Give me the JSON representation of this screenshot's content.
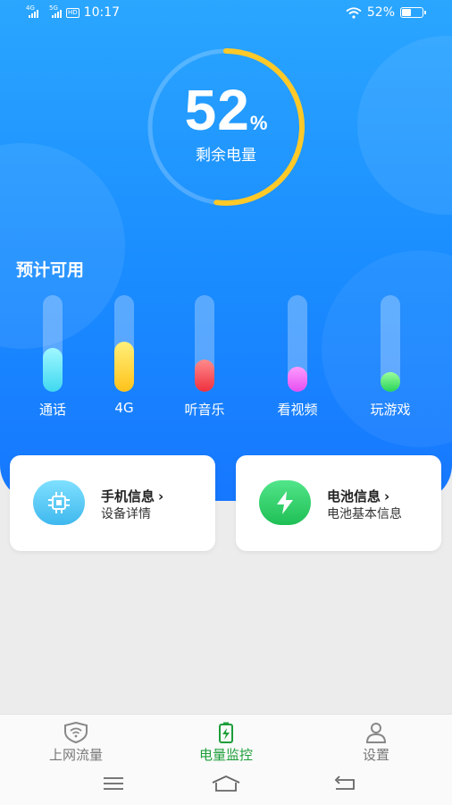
{
  "status": {
    "sig1": "4G",
    "sig2": "5G",
    "hd": "HD",
    "time": "10:17",
    "battery": "52%",
    "battery_level": 0.52
  },
  "gauge": {
    "value": "52",
    "unit": "%",
    "label": "剩余电量",
    "level": 0.52
  },
  "estimate": {
    "title": "预计可用",
    "bars": [
      {
        "label": "通话",
        "level": 0.45,
        "color_top": "#9ff8ff",
        "color_bottom": "#3fd8f0"
      },
      {
        "label": "4G",
        "level": 0.52,
        "color_top": "#fff07a",
        "color_bottom": "#ffc21a"
      },
      {
        "label": "听音乐",
        "level": 0.33,
        "color_top": "#ff8b8b",
        "color_bottom": "#ee2f3e"
      },
      {
        "label": "看视频",
        "level": 0.26,
        "color_top": "#ff9cff",
        "color_bottom": "#e64ef0"
      },
      {
        "label": "玩游戏",
        "level": 0.2,
        "color_top": "#9bff9b",
        "color_bottom": "#27d35a"
      }
    ]
  },
  "cards": [
    {
      "title": "手机信息",
      "desc": "设备详情",
      "icon": "chip-icon",
      "color": "#5cc9f5"
    },
    {
      "title": "电池信息",
      "desc": "电池基本信息",
      "icon": "lightning-icon",
      "color": "#2fd26c"
    }
  ],
  "nav": [
    {
      "label": "上网流量",
      "icon": "wifi-shield-icon"
    },
    {
      "label": "电量监控",
      "icon": "battery-monitor-icon",
      "active": true
    },
    {
      "label": "设置",
      "icon": "person-icon"
    }
  ],
  "colors": {
    "primary": "#1a8cff",
    "accent_green": "#1e9e3a",
    "gauge_arc": "#ffc928"
  }
}
